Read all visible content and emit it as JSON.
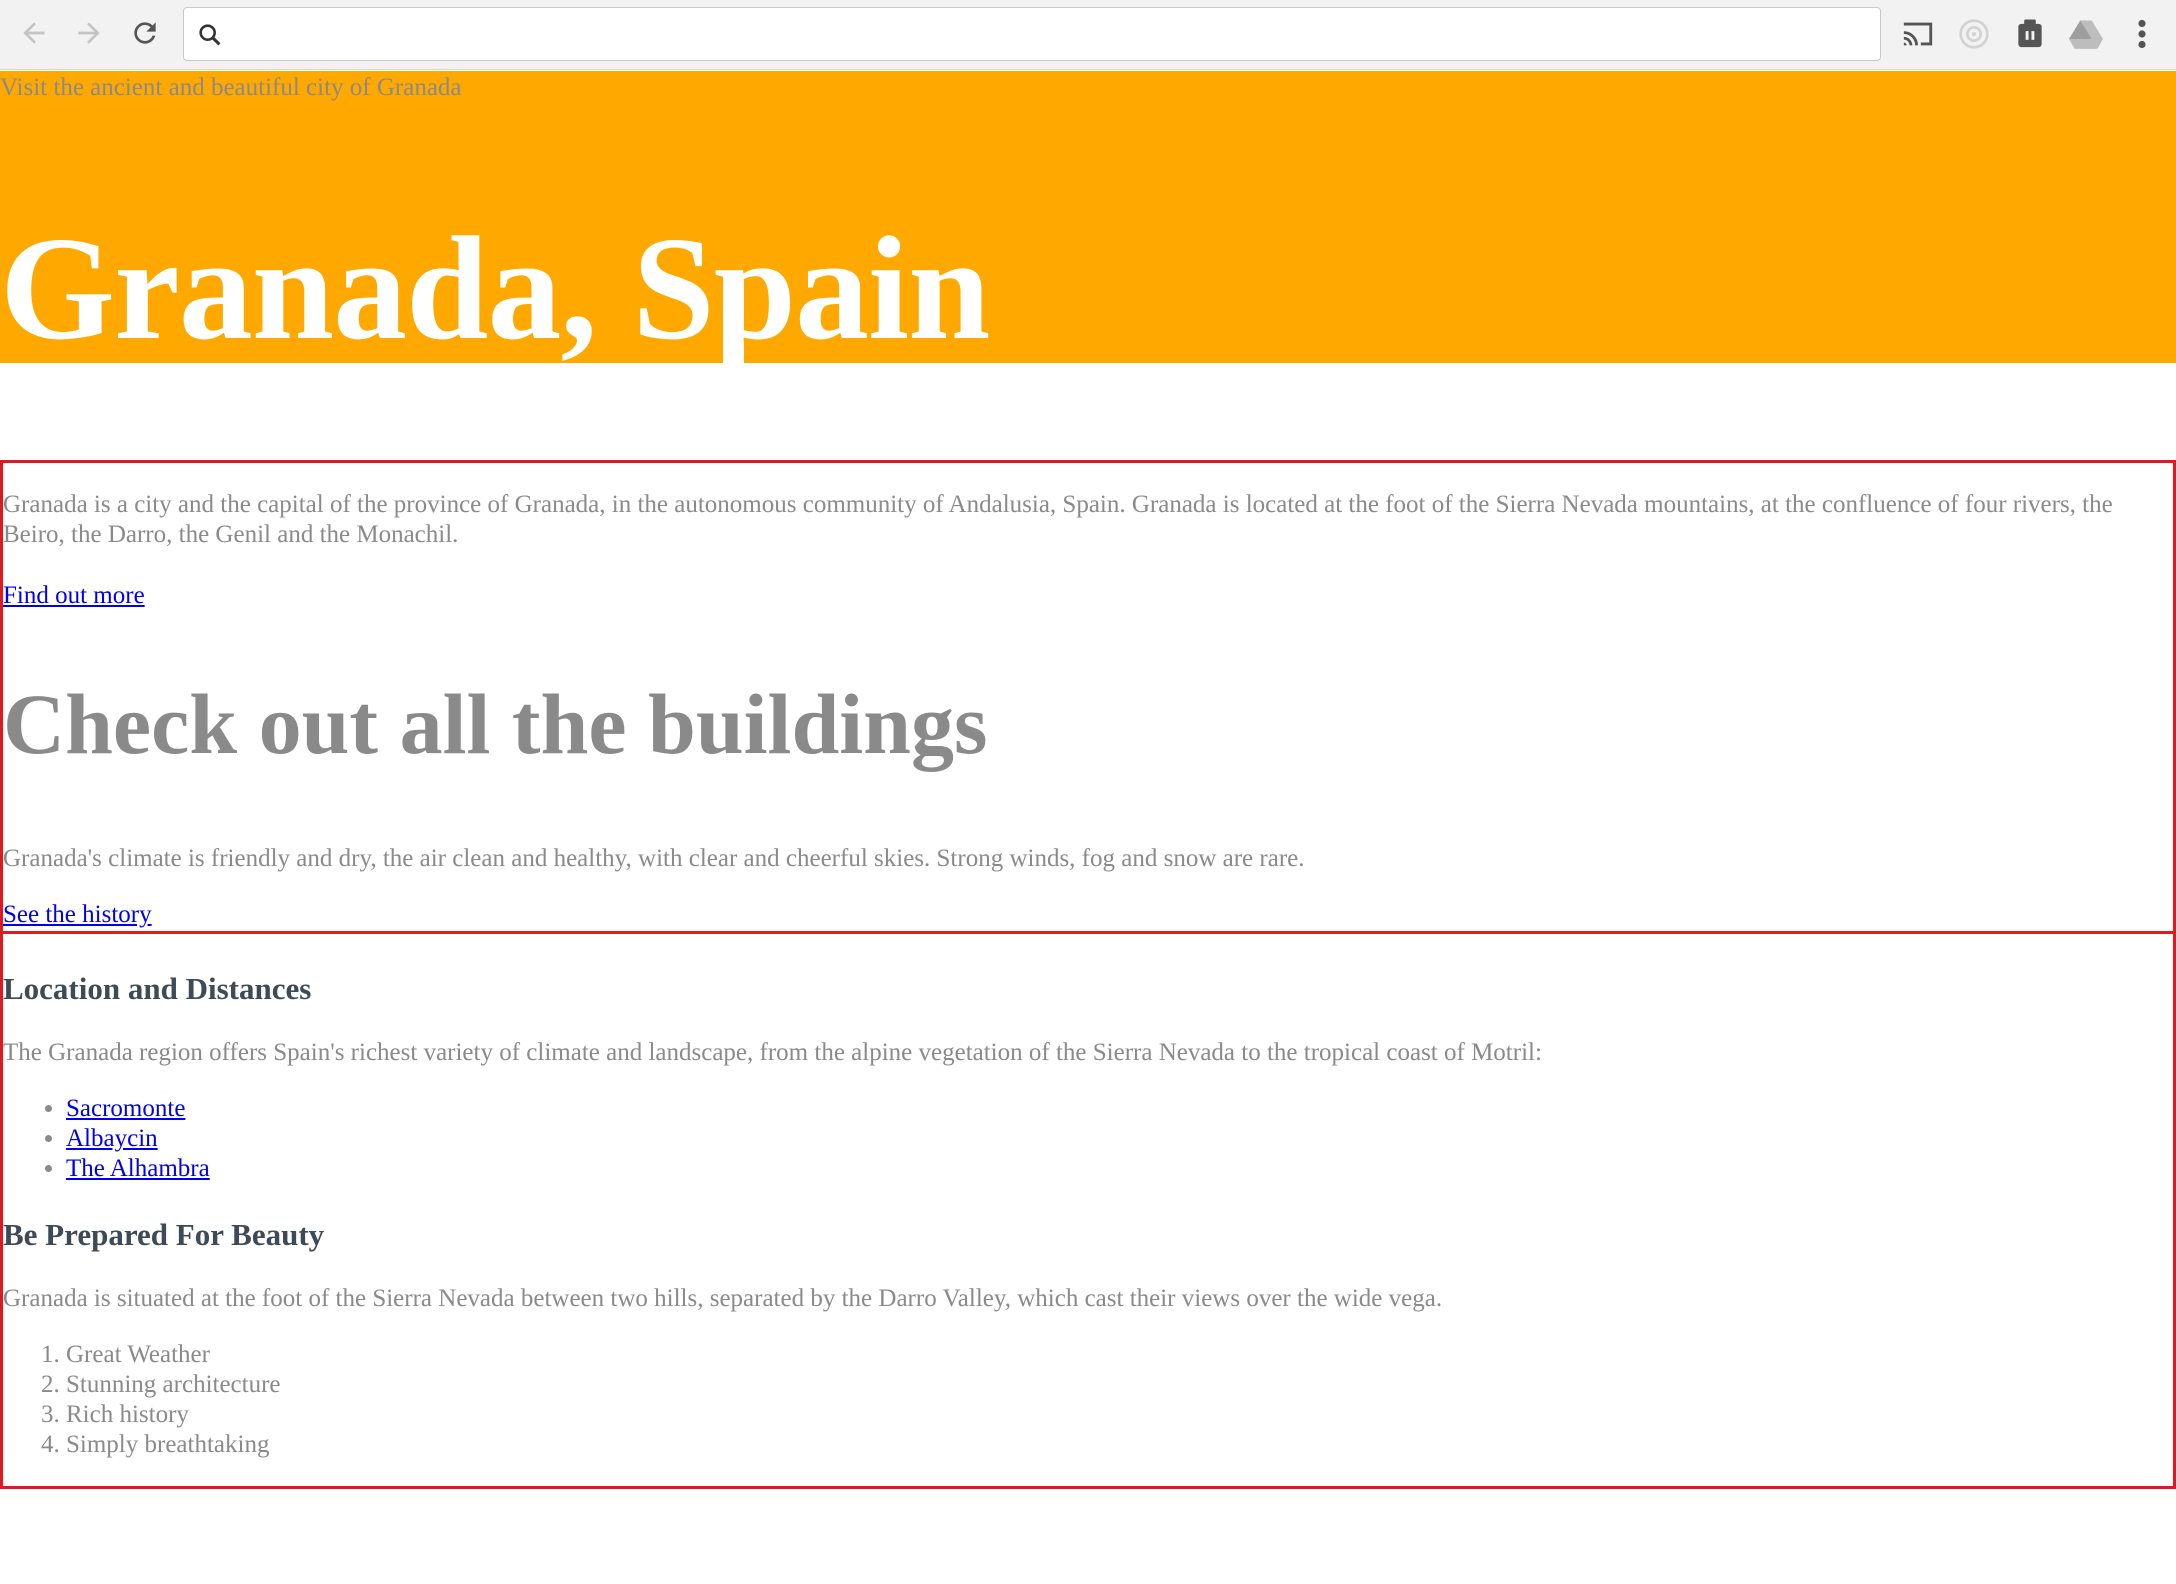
{
  "browser": {
    "url": "",
    "icons": [
      "back-arrow-icon",
      "forward-arrow-icon",
      "reload-icon",
      "search-icon",
      "cast-icon",
      "extension-circle-icon",
      "extension-puzzle-icon",
      "drive-icon",
      "menu-dots-icon"
    ]
  },
  "hero": {
    "tagline": "Visit the ancient and beautiful city of Granada",
    "title": "Granada, Spain",
    "background": "#ffa800"
  },
  "section1": {
    "intro": "Granada is a city and the capital of the province of Granada, in the autonomous community of Andalusia, Spain. Granada is located at the foot of the Sierra Nevada mountains, at the confluence of four rivers, the Beiro, the Darro, the Genil and the Monachil.",
    "link1": "Find out more",
    "heading": "Check out all the buildings",
    "climate": "Granada's climate is friendly and dry, the air clean and healthy, with clear and cheerful skies. Strong winds, fog and snow are rare.",
    "link2": "See the history"
  },
  "section2": {
    "heading1": "Location and Distances",
    "region": "The Granada region offers Spain's richest variety of climate and landscape, from the alpine vegetation of the Sierra Nevada to the tropical coast of Motril:",
    "places": [
      "Sacromonte",
      "Albaycin",
      "The Alhambra"
    ],
    "heading2": "Be Prepared For Beauty",
    "situated": "Granada is situated at the foot of the Sierra Nevada between two hills, separated by the Darro Valley, which cast their views over the wide vega.",
    "reasons": [
      "Great Weather",
      "Stunning architecture",
      "Rich history",
      "Simply breathtaking"
    ]
  },
  "colors": {
    "border": "#e0181f",
    "text": "#8a8a8a",
    "heading": "#3e4a56",
    "link": "#0000ee"
  }
}
